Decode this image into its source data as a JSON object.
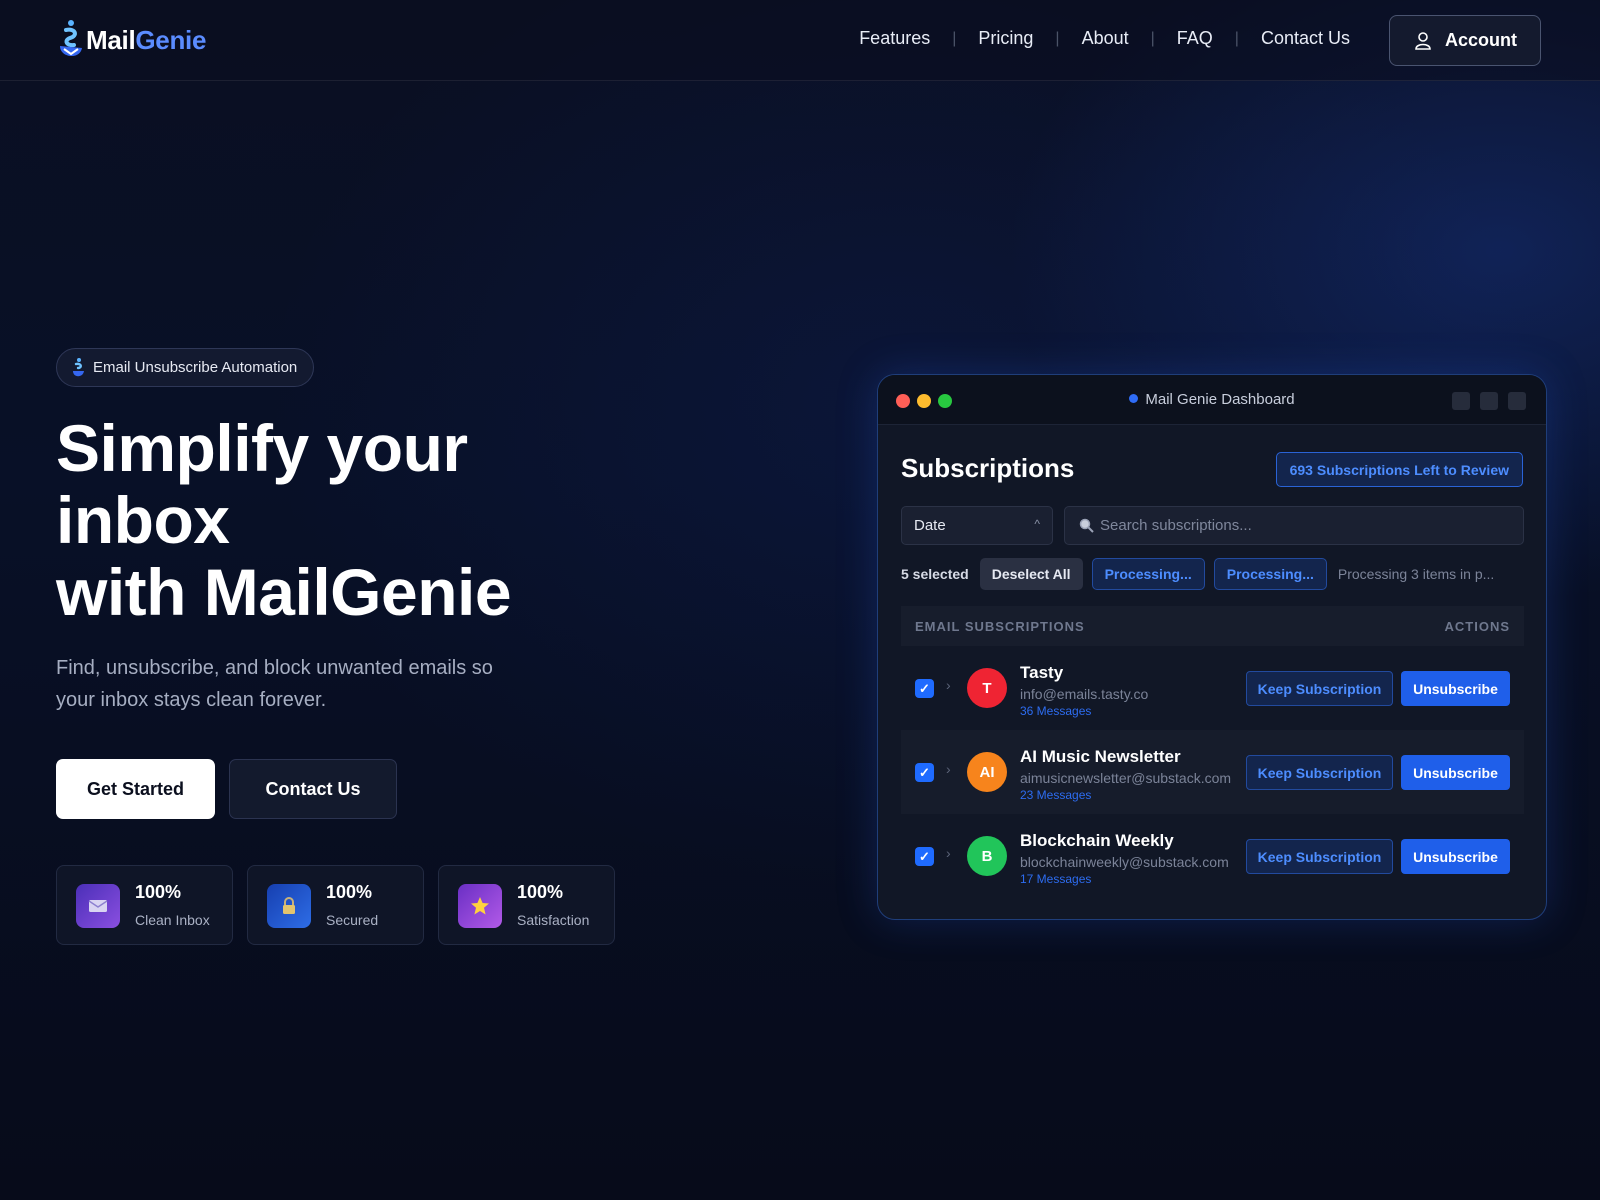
{
  "brand": {
    "mail": "Mail",
    "genie": "Genie"
  },
  "nav": {
    "links": [
      "Features",
      "Pricing",
      "About",
      "FAQ",
      "Contact Us"
    ],
    "account_label": "Account"
  },
  "hero": {
    "badge": "Email Unsubscribe Automation",
    "title_lines": [
      "Simplify your",
      "inbox",
      "with MailGenie"
    ],
    "subtitle": "Find, unsubscribe, and block unwanted emails so your inbox stays clean forever.",
    "primary_button": "Get Started",
    "secondary_button": "Contact Us"
  },
  "stats": [
    {
      "value": "100%",
      "label": "Clean Inbox",
      "icon": "envelope-icon",
      "color": "#6d3fc6"
    },
    {
      "value": "100%",
      "label": "Secured",
      "icon": "lock-icon",
      "color": "#1e4fd0"
    },
    {
      "value": "100%",
      "label": "Satisfaction",
      "icon": "star-icon",
      "color": "#8a3fd6"
    }
  ],
  "dashboard": {
    "window_title": "Mail Genie Dashboard",
    "heading": "Subscriptions",
    "review_badge": "693 Subscriptions Left to Review",
    "sort_value": "Date",
    "search_placeholder": "Search subscriptions...",
    "selected_count": "5 selected",
    "deselect_label": "Deselect All",
    "processing_1": "Processing...",
    "processing_2": "Processing...",
    "processing_note": "Processing 3 items in p...",
    "table_header_left": "EMAIL SUBSCRIPTIONS",
    "table_header_right": "ACTIONS",
    "keep_label": "Keep Subscription",
    "unsubscribe_label": "Unsubscribe",
    "rows": [
      {
        "initial": "T",
        "name": "Tasty",
        "email": "info@emails.tasty.co",
        "messages": "36 Messages",
        "color": "#ef2433"
      },
      {
        "initial": "AI",
        "name": "AI Music Newsletter",
        "email": "aimusicnewsletter@substack.com",
        "messages": "23 Messages",
        "color": "#f7841c"
      },
      {
        "initial": "B",
        "name": "Blockchain Weekly",
        "email": "blockchainweekly@substack.com",
        "messages": "17 Messages",
        "color": "#21c55a"
      }
    ]
  },
  "colors": {
    "accent": "#1f5fea",
    "accent_text": "#4d8dff",
    "background": "#081027"
  }
}
